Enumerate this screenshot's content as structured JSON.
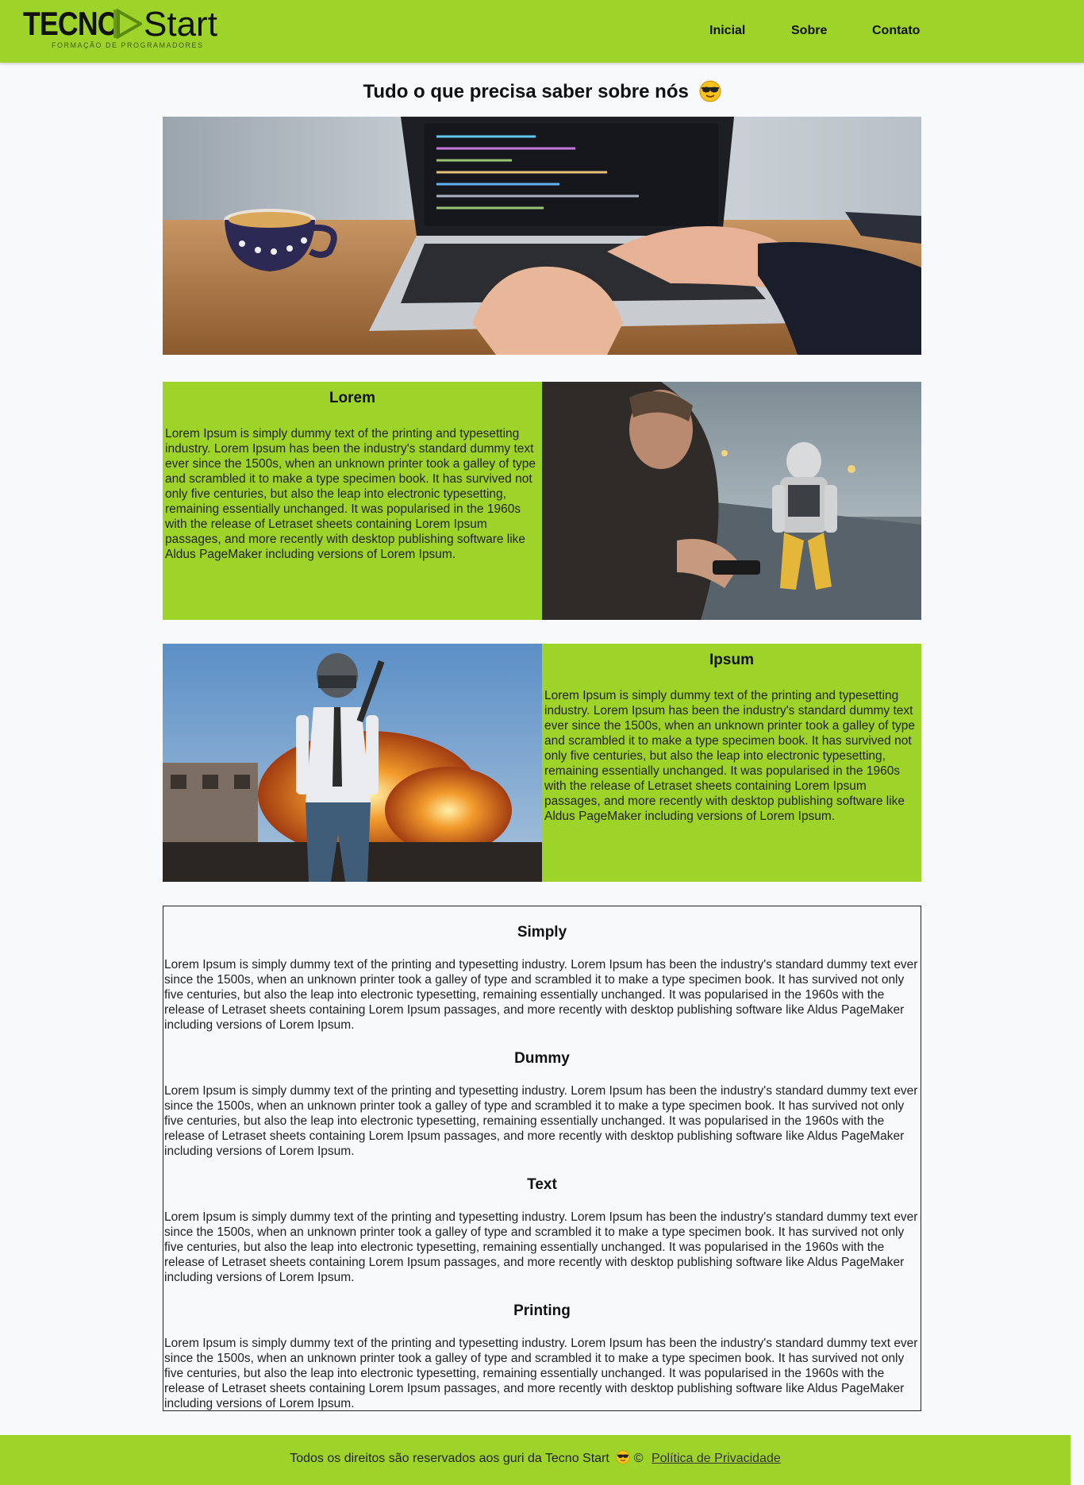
{
  "brand": {
    "name_bold": "TECNO",
    "name_light": "Start",
    "tagline": "FORMAÇÃO DE PROGRAMADORES",
    "accent": "#9ed42a"
  },
  "nav": {
    "items": [
      {
        "label": "Inicial"
      },
      {
        "label": "Sobre"
      },
      {
        "label": "Contato"
      }
    ]
  },
  "main": {
    "title": "Tudo o que precisa saber sobre nós",
    "title_emoji": "sunglasses-emoji",
    "hero_image": "laptop-coding-photo",
    "sections": [
      {
        "heading": "Lorem",
        "text": "Lorem Ipsum is simply dummy text of the printing and typesetting industry. Lorem Ipsum has been the industry's standard dummy text ever since the 1500s, when an unknown printer took a galley of type and scrambled it to make a type specimen book. It has survived not only five centuries, but also the leap into electronic typesetting, remaining essentially unchanged. It was popularised in the 1960s with the release of Letraset sheets containing Lorem Ipsum passages, and more recently with desktop publishing software like Aldus PageMaker including versions of Lorem Ipsum.",
        "image": "quantum-break-game-art"
      },
      {
        "heading": "Ipsum",
        "text": "Lorem Ipsum is simply dummy text of the printing and typesetting industry. Lorem Ipsum has been the industry's standard dummy text ever since the 1500s, when an unknown printer took a galley of type and scrambled it to make a type specimen book. It has survived not only five centuries, but also the leap into electronic typesetting, remaining essentially unchanged. It was popularised in the 1960s with the release of Letraset sheets containing Lorem Ipsum passages, and more recently with desktop publishing software like Aldus PageMaker including versions of Lorem Ipsum.",
        "image": "pubg-game-art"
      }
    ],
    "articles": [
      {
        "heading": "Simply",
        "text": "Lorem Ipsum is simply dummy text of the printing and typesetting industry. Lorem Ipsum has been the industry's standard dummy text ever since the 1500s, when an unknown printer took a galley of type and scrambled it to make a type specimen book. It has survived not only five centuries, but also the leap into electronic typesetting, remaining essentially unchanged. It was popularised in the 1960s with the release of Letraset sheets containing Lorem Ipsum passages, and more recently with desktop publishing software like Aldus PageMaker including versions of Lorem Ipsum."
      },
      {
        "heading": "Dummy",
        "text": "Lorem Ipsum is simply dummy text of the printing and typesetting industry. Lorem Ipsum has been the industry's standard dummy text ever since the 1500s, when an unknown printer took a galley of type and scrambled it to make a type specimen book. It has survived not only five centuries, but also the leap into electronic typesetting, remaining essentially unchanged. It was popularised in the 1960s with the release of Letraset sheets containing Lorem Ipsum passages, and more recently with desktop publishing software like Aldus PageMaker including versions of Lorem Ipsum."
      },
      {
        "heading": "Text",
        "text": "Lorem Ipsum is simply dummy text of the printing and typesetting industry. Lorem Ipsum has been the industry's standard dummy text ever since the 1500s, when an unknown printer took a galley of type and scrambled it to make a type specimen book. It has survived not only five centuries, but also the leap into electronic typesetting, remaining essentially unchanged. It was popularised in the 1960s with the release of Letraset sheets containing Lorem Ipsum passages, and more recently with desktop publishing software like Aldus PageMaker including versions of Lorem Ipsum."
      },
      {
        "heading": "Printing",
        "text": "Lorem Ipsum is simply dummy text of the printing and typesetting industry. Lorem Ipsum has been the industry's standard dummy text ever since the 1500s, when an unknown printer took a galley of type and scrambled it to make a type specimen book. It has survived not only five centuries, but also the leap into electronic typesetting, remaining essentially unchanged. It was popularised in the 1960s with the release of Letraset sheets containing Lorem Ipsum passages, and more recently with desktop publishing software like Aldus PageMaker including versions of Lorem Ipsum."
      }
    ]
  },
  "footer": {
    "text": "Todos os direitos são reservados aos guri da Tecno Start",
    "copyright": "©",
    "privacy_link": "Política de Privacidade"
  }
}
